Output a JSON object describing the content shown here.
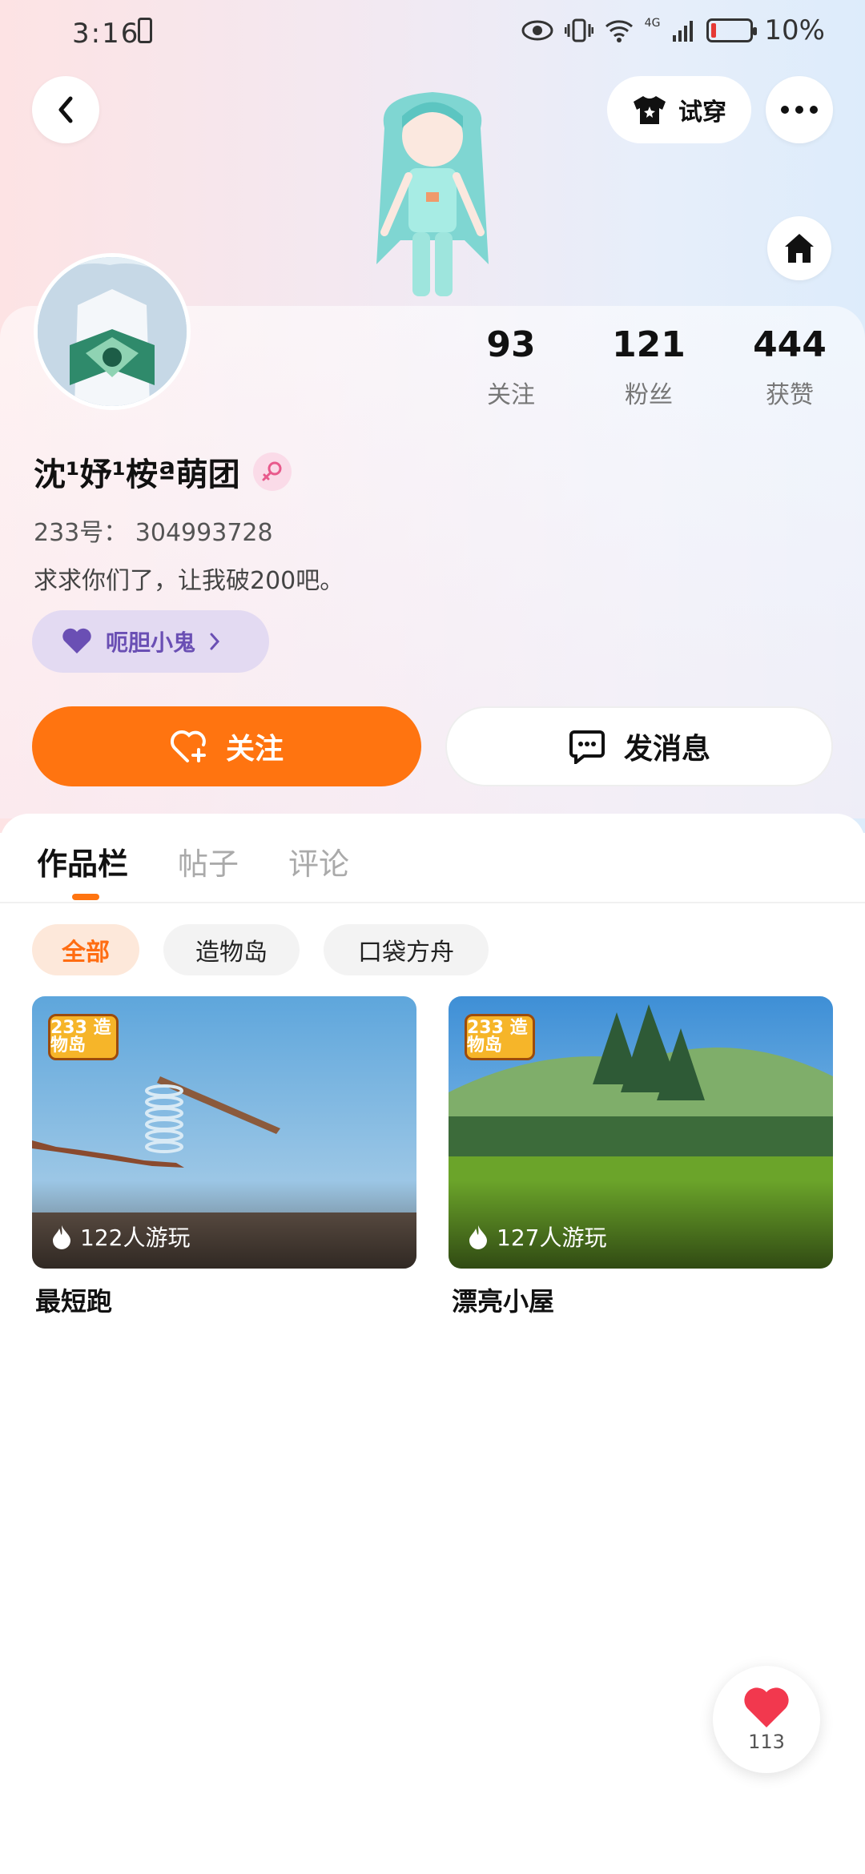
{
  "status_bar": {
    "time": "3:16",
    "battery": "10%",
    "network": "4G"
  },
  "header": {
    "try_on_label": "试穿"
  },
  "profile": {
    "stats": [
      {
        "value": "93",
        "label": "关注"
      },
      {
        "value": "121",
        "label": "粉丝"
      },
      {
        "value": "444",
        "label": "获赞"
      }
    ],
    "name": "沈¹妤¹桉ª萌团",
    "uid": "233号： 304993728",
    "bio": "求求你们了，让我破200吧。",
    "badge_label": "呃胆小鬼",
    "follow_label": "关注",
    "message_label": "发消息"
  },
  "tabs": [
    "作品栏",
    "帖子",
    "评论"
  ],
  "filters": [
    "全部",
    "造物岛",
    "口袋方舟"
  ],
  "works": [
    {
      "title": "最短跑",
      "plays": "122人游玩",
      "logo": "233 造物岛"
    },
    {
      "title": "漂亮小屋",
      "plays": "127人游玩",
      "logo": "233 造物岛"
    }
  ],
  "like_count": "113",
  "colors": {
    "accent": "#ff7410",
    "badge_bg": "#e3daf2",
    "badge_text": "#6a4fb4"
  }
}
